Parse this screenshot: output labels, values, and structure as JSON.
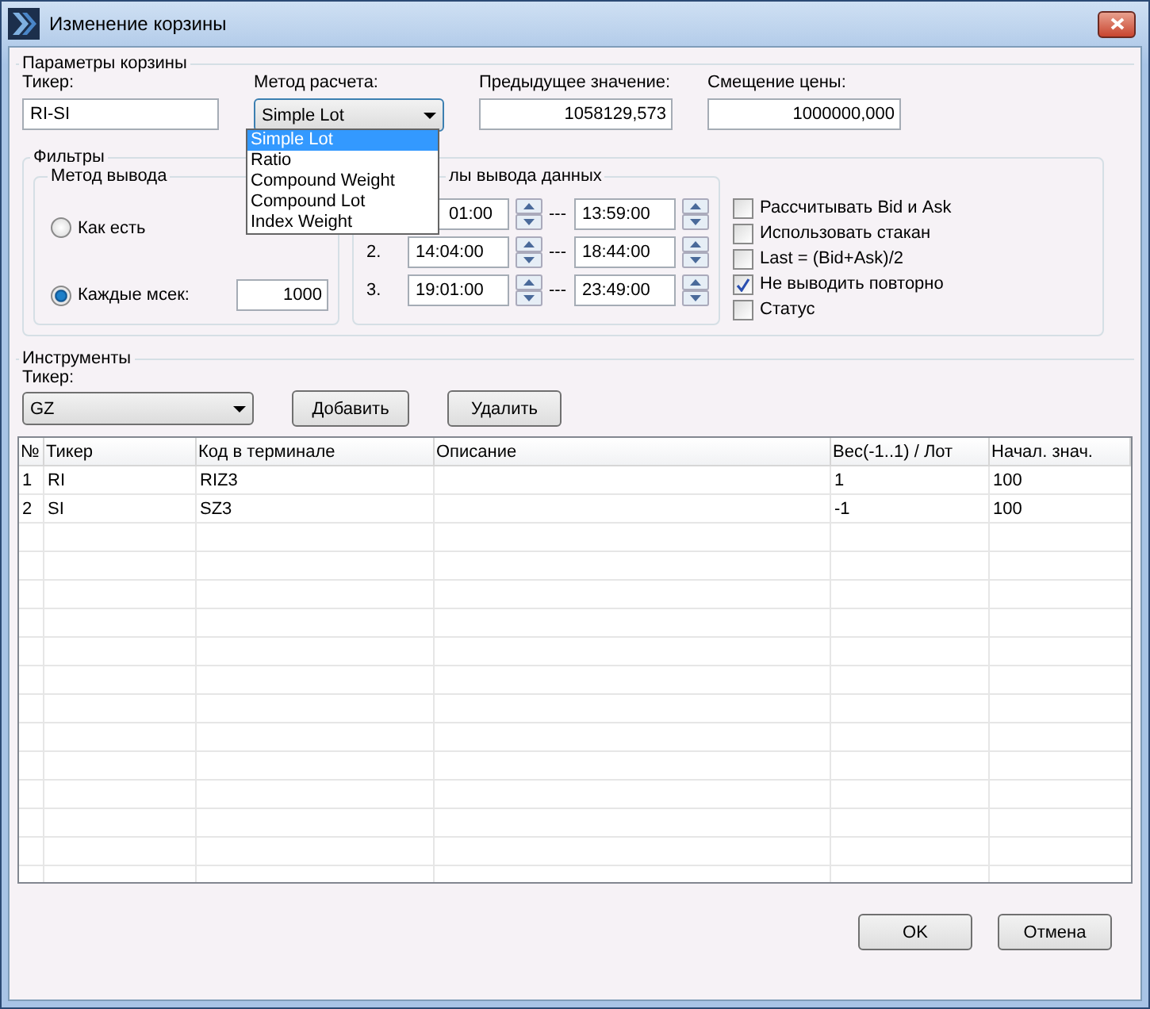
{
  "window": {
    "title": "Изменение корзины"
  },
  "params": {
    "title": "Параметры корзины",
    "ticker": {
      "label": "Тикер:",
      "value": "RI-SI"
    },
    "method": {
      "label": "Метод расчета:",
      "value": "Simple Lot",
      "expanded": true,
      "options": [
        {
          "label": "Simple Lot",
          "selected": true
        },
        {
          "label": "Ratio",
          "selected": false
        },
        {
          "label": "Compound Weight",
          "selected": false
        },
        {
          "label": "Compound Lot",
          "selected": false
        },
        {
          "label": "Index Weight",
          "selected": false
        }
      ]
    },
    "previous": {
      "label": "Предыдущее значение:",
      "value": "1058129,573"
    },
    "shift": {
      "label": "Смещение цены:",
      "value": "1000000,000"
    }
  },
  "filters": {
    "title": "Фильтры",
    "output_method": {
      "title": "Метод вывода",
      "radios": [
        {
          "label": "Как есть",
          "selected": false
        },
        {
          "label": "Каждые мсек:",
          "selected": true,
          "value": "1000"
        }
      ]
    },
    "intervals": {
      "title": "лы вывода данных",
      "separator": "---",
      "rows": [
        {
          "from": "01:00",
          "to": "13:59:00"
        },
        {
          "number": "2.",
          "from": "14:04:00",
          "to": "18:44:00"
        },
        {
          "number": "3.",
          "from": "19:01:00",
          "to": "23:49:00"
        }
      ]
    },
    "checkboxes": [
      {
        "label": "Рассчитывать Bid и Ask",
        "checked": false
      },
      {
        "label": "Использовать стакан",
        "checked": false
      },
      {
        "label": "Last = (Bid+Ask)/2",
        "checked": false
      },
      {
        "label": "Не выводить повторно",
        "checked": true
      },
      {
        "label": "Статус",
        "checked": false
      }
    ]
  },
  "instruments": {
    "title": "Инструменты",
    "ticker_label": "Тикер:",
    "ticker_value": "GZ",
    "buttons": [
      "Добавить",
      "Удалить"
    ]
  },
  "table": {
    "columns": [
      "№",
      "Тикер",
      "Код в терминале",
      "Описание",
      "Вес(-1..1) / Лот",
      "Начал. знач."
    ],
    "rows": [
      [
        "1",
        "RI",
        "RIZ3",
        "",
        "1",
        "100"
      ],
      [
        "2",
        "SI",
        "SZ3",
        "",
        "-1",
        "100"
      ]
    ]
  },
  "buttons": [
    "OK",
    "Отмена"
  ]
}
